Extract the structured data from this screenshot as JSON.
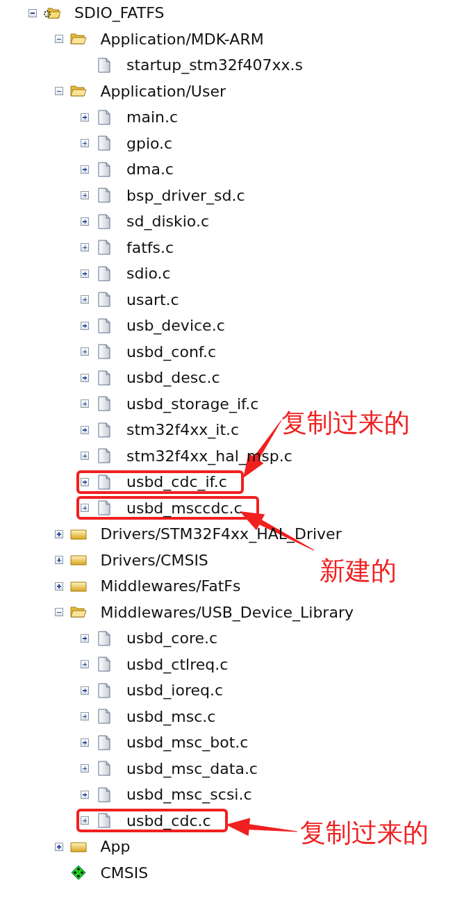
{
  "project_tree": {
    "root": {
      "label": "SDIO_FATFS",
      "kind": "project",
      "expanded": true,
      "children": [
        {
          "label": "Application/MDK-ARM",
          "kind": "group",
          "expanded": true,
          "children": [
            {
              "label": "startup_stm32f407xx.s",
              "kind": "file"
            }
          ]
        },
        {
          "label": "Application/User",
          "kind": "group",
          "expanded": true,
          "children": [
            {
              "label": "main.c",
              "kind": "file",
              "expanded": false
            },
            {
              "label": "gpio.c",
              "kind": "file",
              "expanded": false
            },
            {
              "label": "dma.c",
              "kind": "file",
              "expanded": false
            },
            {
              "label": "bsp_driver_sd.c",
              "kind": "file",
              "expanded": false
            },
            {
              "label": "sd_diskio.c",
              "kind": "file",
              "expanded": false
            },
            {
              "label": "fatfs.c",
              "kind": "file",
              "expanded": false
            },
            {
              "label": "sdio.c",
              "kind": "file",
              "expanded": false
            },
            {
              "label": "usart.c",
              "kind": "file",
              "expanded": false
            },
            {
              "label": "usb_device.c",
              "kind": "file",
              "expanded": false
            },
            {
              "label": "usbd_conf.c",
              "kind": "file",
              "expanded": false
            },
            {
              "label": "usbd_desc.c",
              "kind": "file",
              "expanded": false
            },
            {
              "label": "usbd_storage_if.c",
              "kind": "file",
              "expanded": false
            },
            {
              "label": "stm32f4xx_it.c",
              "kind": "file",
              "expanded": false
            },
            {
              "label": "stm32f4xx_hal_msp.c",
              "kind": "file",
              "expanded": false
            },
            {
              "label": "usbd_cdc_if.c",
              "kind": "file",
              "expanded": false,
              "highlighted": true
            },
            {
              "label": "usbd_msccdc.c",
              "kind": "file",
              "expanded": false,
              "highlighted": true
            }
          ]
        },
        {
          "label": "Drivers/STM32F4xx_HAL_Driver",
          "kind": "group",
          "expanded": false
        },
        {
          "label": "Drivers/CMSIS",
          "kind": "group",
          "expanded": false
        },
        {
          "label": "Middlewares/FatFs",
          "kind": "group",
          "expanded": false
        },
        {
          "label": "Middlewares/USB_Device_Library",
          "kind": "group",
          "expanded": true,
          "children": [
            {
              "label": "usbd_core.c",
              "kind": "file",
              "expanded": false
            },
            {
              "label": "usbd_ctlreq.c",
              "kind": "file",
              "expanded": false
            },
            {
              "label": "usbd_ioreq.c",
              "kind": "file",
              "expanded": false
            },
            {
              "label": "usbd_msc.c",
              "kind": "file",
              "expanded": false
            },
            {
              "label": "usbd_msc_bot.c",
              "kind": "file",
              "expanded": false
            },
            {
              "label": "usbd_msc_data.c",
              "kind": "file",
              "expanded": false
            },
            {
              "label": "usbd_msc_scsi.c",
              "kind": "file",
              "expanded": false
            },
            {
              "label": "usbd_cdc.c",
              "kind": "file",
              "expanded": false,
              "highlighted": true
            }
          ]
        },
        {
          "label": "App",
          "kind": "group",
          "expanded": false
        },
        {
          "label": "CMSIS",
          "kind": "component"
        }
      ]
    }
  },
  "annotations": [
    {
      "text": "复制过来的"
    },
    {
      "text": "新建的"
    },
    {
      "text": "复制过来的"
    }
  ]
}
